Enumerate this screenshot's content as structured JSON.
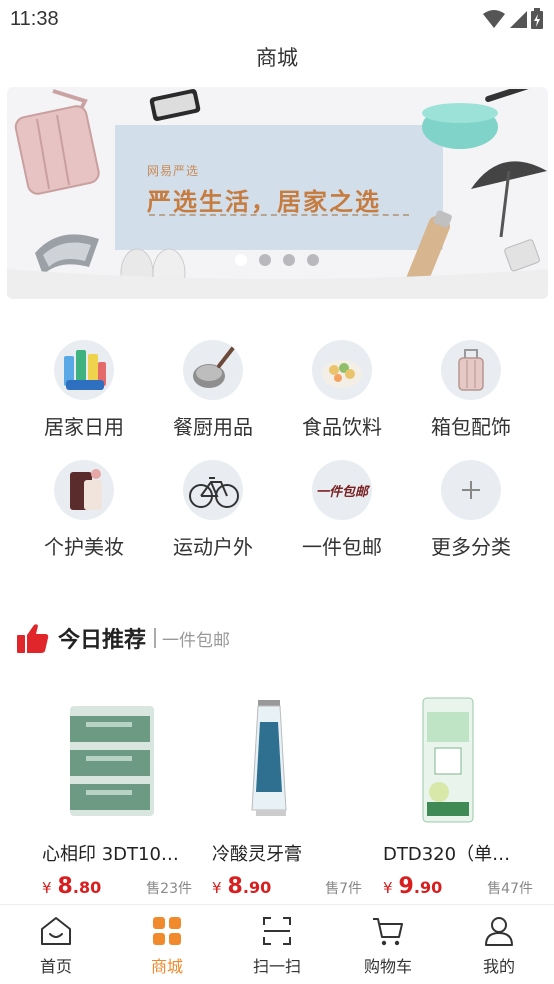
{
  "status_bar": {
    "time": "11:38"
  },
  "header": {
    "title": "商城"
  },
  "banner": {
    "brand": "网易严选",
    "slogan": "严选生活，居家之选",
    "active_dot": 0,
    "dot_count": 4
  },
  "categories": [
    {
      "label": "居家日用",
      "icon": "household-icon"
    },
    {
      "label": "餐厨用品",
      "icon": "kitchen-pan-icon"
    },
    {
      "label": "食品饮料",
      "icon": "food-bowl-icon"
    },
    {
      "label": "箱包配饰",
      "icon": "luggage-icon"
    },
    {
      "label": "个护美妆",
      "icon": "cosmetics-icon"
    },
    {
      "label": "运动户外",
      "icon": "bicycle-icon"
    },
    {
      "label": "一件包邮",
      "icon": "free-shipping-icon",
      "icon_text": "一件包邮"
    },
    {
      "label": "更多分类",
      "icon": "plus-icon"
    }
  ],
  "recommend": {
    "title": "今日推荐",
    "subtitle": "一件包邮"
  },
  "products": [
    {
      "name": "心相印 3DT10…",
      "currency": "¥",
      "price_int": "8",
      "price_dec": ".80",
      "sold": "售23件"
    },
    {
      "name": "冷酸灵牙膏",
      "currency": "¥",
      "price_int": "8",
      "price_dec": ".90",
      "sold": "售7件"
    },
    {
      "name": "DTD320（单…",
      "currency": "¥",
      "price_int": "9",
      "price_dec": ".90",
      "sold": "售47件"
    }
  ],
  "tabs": [
    {
      "label": "首页",
      "icon": "home-icon"
    },
    {
      "label": "商城",
      "icon": "grid-icon",
      "active": true
    },
    {
      "label": "扫一扫",
      "icon": "scan-icon"
    },
    {
      "label": "购物车",
      "icon": "cart-icon"
    },
    {
      "label": "我的",
      "icon": "user-icon"
    }
  ],
  "colors": {
    "accent": "#f08a2c",
    "price": "#d81e1e",
    "thumb": "#e0262a"
  }
}
